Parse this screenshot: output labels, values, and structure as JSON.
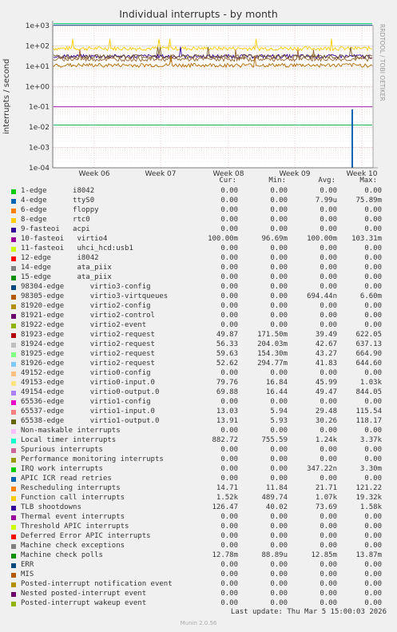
{
  "chart_data": {
    "type": "line",
    "title": "Individual interrupts - by month",
    "ylabel": "interrupts / second",
    "yscale": "log",
    "ylim": [
      0.0001,
      1000
    ],
    "ytick_labels": [
      "1e+03",
      "1e+02",
      "1e+01",
      "1e+00",
      "1e-01",
      "1e-02",
      "1e-03",
      "1e-04"
    ],
    "xtick_labels": [
      "Week 06",
      "Week 07",
      "Week 08",
      "Week 09",
      "Week 10"
    ],
    "grid": true,
    "watermark": "RRDTOOL / TOBI OETIKER",
    "series_lines": [
      {
        "name": "Local timer interrupts",
        "color": "#00cc66",
        "value": 1240
      },
      {
        "name": "TLB shootdowns",
        "color": "#ffcc00",
        "value": 73.69
      },
      {
        "name": "Function call interrupts",
        "color": "#0066b3",
        "value": 1070
      },
      {
        "name": "10-fasteoi virtio4",
        "color": "#990099",
        "value": 0.1
      },
      {
        "name": "Machine check polls",
        "color": "#00aa44",
        "value": 0.01285
      },
      {
        "name": "65538-edge virtio1-output.0",
        "color": "#330099",
        "value": 30.26
      },
      {
        "name": "65537-edge virtio1-input.0",
        "color": "#7b5b2b",
        "value": 29.48
      },
      {
        "name": "Rescheduling interrupts",
        "color": "#996633",
        "value": 21.71
      },
      {
        "name": "98305-edge virtio3-virtqueues",
        "color": "#b36b00",
        "value": 11
      }
    ]
  },
  "legend_header": {
    "cur": "Cur:",
    "min": "Min:",
    "avg": "Avg:",
    "max": "Max:"
  },
  "legend": [
    {
      "name": "1-edge      i8042",
      "color": "#00cc00",
      "cur": "0.00",
      "min": "0.00",
      "avg": "0.00",
      "max": "0.00"
    },
    {
      "name": "4-edge      ttyS0",
      "color": "#0066b3",
      "cur": "0.00",
      "min": "0.00",
      "avg": "7.99u",
      "max": "75.89m"
    },
    {
      "name": "6-edge      floppy",
      "color": "#ff8000",
      "cur": "0.00",
      "min": "0.00",
      "avg": "0.00",
      "max": "0.00"
    },
    {
      "name": "8-edge      rtc0",
      "color": "#ffcc00",
      "cur": "0.00",
      "min": "0.00",
      "avg": "0.00",
      "max": "0.00"
    },
    {
      "name": "9-fasteoi   acpi",
      "color": "#330099",
      "cur": "0.00",
      "min": "0.00",
      "avg": "0.00",
      "max": "0.00"
    },
    {
      "name": "10-fasteoi   virtio4",
      "color": "#990099",
      "cur": "100.00m",
      "min": "96.69m",
      "avg": "100.00m",
      "max": "103.31m"
    },
    {
      "name": "11-fasteoi   uhci_hcd:usb1",
      "color": "#ccff00",
      "cur": "0.00",
      "min": "0.00",
      "avg": "0.00",
      "max": "0.00"
    },
    {
      "name": "12-edge      i8042",
      "color": "#ff0000",
      "cur": "0.00",
      "min": "0.00",
      "avg": "0.00",
      "max": "0.00"
    },
    {
      "name": "14-edge      ata_piix",
      "color": "#808080",
      "cur": "0.00",
      "min": "0.00",
      "avg": "0.00",
      "max": "0.00"
    },
    {
      "name": "15-edge      ata_piix",
      "color": "#008f00",
      "cur": "0.00",
      "min": "0.00",
      "avg": "0.00",
      "max": "0.00"
    },
    {
      "name": "98304-edge      virtio3-config",
      "color": "#00487d",
      "cur": "0.00",
      "min": "0.00",
      "avg": "0.00",
      "max": "0.00"
    },
    {
      "name": "98305-edge      virtio3-virtqueues",
      "color": "#b35a00",
      "cur": "0.00",
      "min": "0.00",
      "avg": "694.44n",
      "max": "6.60m"
    },
    {
      "name": "81920-edge      virtio2-config",
      "color": "#b38f00",
      "cur": "0.00",
      "min": "0.00",
      "avg": "0.00",
      "max": "0.00"
    },
    {
      "name": "81921-edge      virtio2-control",
      "color": "#6b006b",
      "cur": "0.00",
      "min": "0.00",
      "avg": "0.00",
      "max": "0.00"
    },
    {
      "name": "81922-edge      virtio2-event",
      "color": "#8fb300",
      "cur": "0.00",
      "min": "0.00",
      "avg": "0.00",
      "max": "0.00"
    },
    {
      "name": "81923-edge      virtio2-request",
      "color": "#b30000",
      "cur": "49.87",
      "min": "171.50m",
      "avg": "39.49",
      "max": "622.05"
    },
    {
      "name": "81924-edge      virtio2-request",
      "color": "#bebebe",
      "cur": "56.33",
      "min": "204.03m",
      "avg": "42.67",
      "max": "637.13"
    },
    {
      "name": "81925-edge      virtio2-request",
      "color": "#80ff80",
      "cur": "59.63",
      "min": "154.30m",
      "avg": "43.27",
      "max": "664.90"
    },
    {
      "name": "81926-edge      virtio2-request",
      "color": "#80c9ff",
      "cur": "52.62",
      "min": "294.77m",
      "avg": "41.83",
      "max": "644.60"
    },
    {
      "name": "49152-edge      virtio0-config",
      "color": "#ffc080",
      "cur": "0.00",
      "min": "0.00",
      "avg": "0.00",
      "max": "0.00"
    },
    {
      "name": "49153-edge      virtio0-input.0",
      "color": "#ffe680",
      "cur": "79.76",
      "min": "16.84",
      "avg": "45.99",
      "max": "1.03k"
    },
    {
      "name": "49154-edge      virtio0-output.0",
      "color": "#aa80ff",
      "cur": "69.88",
      "min": "16.44",
      "avg": "49.47",
      "max": "844.05"
    },
    {
      "name": "65536-edge      virtio1-config",
      "color": "#ee00cc",
      "cur": "0.00",
      "min": "0.00",
      "avg": "0.00",
      "max": "0.00"
    },
    {
      "name": "65537-edge      virtio1-input.0",
      "color": "#ff8080",
      "cur": "13.03",
      "min": "5.94",
      "avg": "29.48",
      "max": "115.54"
    },
    {
      "name": "65538-edge      virtio1-output.0",
      "color": "#666600",
      "cur": "13.91",
      "min": "5.93",
      "avg": "30.26",
      "max": "118.17"
    },
    {
      "name": "Non-maskable interrupts",
      "color": "#ffbfff",
      "cur": "0.00",
      "min": "0.00",
      "avg": "0.00",
      "max": "0.00"
    },
    {
      "name": "Local timer interrupts",
      "color": "#00ffcc",
      "cur": "882.72",
      "min": "755.59",
      "avg": "1.24k",
      "max": "3.37k"
    },
    {
      "name": "Spurious interrupts",
      "color": "#cc6699",
      "cur": "0.00",
      "min": "0.00",
      "avg": "0.00",
      "max": "0.00"
    },
    {
      "name": "Performance monitoring interrupts",
      "color": "#999900",
      "cur": "0.00",
      "min": "0.00",
      "avg": "0.00",
      "max": "0.00"
    },
    {
      "name": "IRQ work interrupts",
      "color": "#00cc00",
      "cur": "0.00",
      "min": "0.00",
      "avg": "347.22n",
      "max": "3.30m"
    },
    {
      "name": "APIC ICR read retries",
      "color": "#0066b3",
      "cur": "0.00",
      "min": "0.00",
      "avg": "0.00",
      "max": "0.00"
    },
    {
      "name": "Rescheduling interrupts",
      "color": "#ff8000",
      "cur": "14.71",
      "min": "11.84",
      "avg": "21.71",
      "max": "121.22"
    },
    {
      "name": "Function call interrupts",
      "color": "#ffcc00",
      "cur": "1.52k",
      "min": "489.74",
      "avg": "1.07k",
      "max": "19.32k"
    },
    {
      "name": "TLB shootdowns",
      "color": "#330099",
      "cur": "126.47",
      "min": "40.02",
      "avg": "73.69",
      "max": "1.58k"
    },
    {
      "name": "Thermal event interrupts",
      "color": "#990099",
      "cur": "0.00",
      "min": "0.00",
      "avg": "0.00",
      "max": "0.00"
    },
    {
      "name": "Threshold APIC interrupts",
      "color": "#ccff00",
      "cur": "0.00",
      "min": "0.00",
      "avg": "0.00",
      "max": "0.00"
    },
    {
      "name": "Deferred Error APIC interrupts",
      "color": "#ff0000",
      "cur": "0.00",
      "min": "0.00",
      "avg": "0.00",
      "max": "0.00"
    },
    {
      "name": "Machine check exceptions",
      "color": "#808080",
      "cur": "0.00",
      "min": "0.00",
      "avg": "0.00",
      "max": "0.00"
    },
    {
      "name": "Machine check polls",
      "color": "#008f00",
      "cur": "12.78m",
      "min": "88.89u",
      "avg": "12.85m",
      "max": "13.87m"
    },
    {
      "name": "ERR",
      "color": "#00487d",
      "cur": "0.00",
      "min": "0.00",
      "avg": "0.00",
      "max": "0.00"
    },
    {
      "name": "MIS",
      "color": "#b35a00",
      "cur": "0.00",
      "min": "0.00",
      "avg": "0.00",
      "max": "0.00"
    },
    {
      "name": "Posted-interrupt notification event",
      "color": "#b38f00",
      "cur": "0.00",
      "min": "0.00",
      "avg": "0.00",
      "max": "0.00"
    },
    {
      "name": "Nested posted-interrupt event",
      "color": "#6b006b",
      "cur": "0.00",
      "min": "0.00",
      "avg": "0.00",
      "max": "0.00"
    },
    {
      "name": "Posted-interrupt wakeup event",
      "color": "#8fb300",
      "cur": "0.00",
      "min": "0.00",
      "avg": "0.00",
      "max": "0.00"
    }
  ],
  "footer": "Last update: Thu Mar  5 15:00:03 2026",
  "munin": "Munin 2.0.56"
}
